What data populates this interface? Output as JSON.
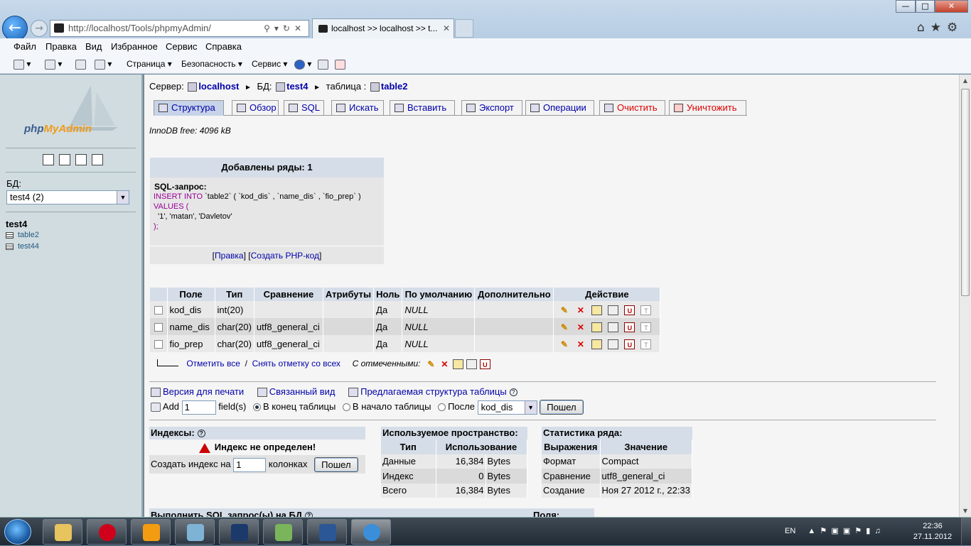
{
  "browser": {
    "address": "http://localhost/Tools/phpmyAdmin/",
    "tab_title": "localhost >> localhost >> t...",
    "menu": [
      "Файл",
      "Правка",
      "Вид",
      "Избранное",
      "Сервис",
      "Справка"
    ],
    "cmd": {
      "page": "Страница",
      "safety": "Безопасность",
      "service": "Сервис"
    }
  },
  "left": {
    "logo_part1": "php",
    "logo_part2": "MyAdmin",
    "db_label": "БД:",
    "db_select": "test4 (2)",
    "db_name": "test4",
    "tables": [
      "table2",
      "test44"
    ]
  },
  "breadcrumb": {
    "server_label": "Сервер:",
    "server": "localhost",
    "db_label": "БД:",
    "db": "test4",
    "table_label": "таблица :",
    "table": "table2"
  },
  "tabs": [
    "Структура",
    "Обзор",
    "SQL",
    "Искать",
    "Вставить",
    "Экспорт",
    "Операции",
    "Очистить",
    "Уничтожить"
  ],
  "innodb": "InnoDB free: 4096 kB",
  "result": {
    "title": "Добавлены ряды: 1",
    "sql_label": "SQL-запрос:",
    "line1_kw": "INSERT INTO",
    "line1_rest": " `table2` ( `kod_dis` , `name_dis` , `fio_prep` )",
    "line2": "VALUES (",
    "line3": "  '1', 'matan', 'Davletov'",
    "line4": ");",
    "link_edit": "Правка",
    "link_php": "Создать PHP-код"
  },
  "structure": {
    "headers": [
      "Поле",
      "Тип",
      "Сравнение",
      "Атрибуты",
      "Ноль",
      "По умолчанию",
      "Дополнительно",
      "Действие"
    ],
    "rows": [
      {
        "field": "kod_dis",
        "type": "int(20)",
        "collation": "",
        "attributes": "",
        "null": "Да",
        "default": "NULL",
        "extra": ""
      },
      {
        "field": "name_dis",
        "type": "char(20)",
        "collation": "utf8_general_ci",
        "attributes": "",
        "null": "Да",
        "default": "NULL",
        "extra": ""
      },
      {
        "field": "fio_prep",
        "type": "char(20)",
        "collation": "utf8_general_ci",
        "attributes": "",
        "null": "Да",
        "default": "NULL",
        "extra": ""
      }
    ],
    "check_all": "Отметить все",
    "sep": "/",
    "uncheck_all": "Снять отметку со всех",
    "with_selected": "С отмеченными:"
  },
  "links": {
    "print": "Версия для печати",
    "relation": "Связанный вид",
    "propose": "Предлагаемая структура таблицы"
  },
  "addfield": {
    "add": "Add",
    "count": "1",
    "fields": "field(s)",
    "opt_end": "В конец таблицы",
    "opt_begin": "В начало таблицы",
    "opt_after": "После",
    "after_field": "kod_dis",
    "go": "Пошел"
  },
  "indexes": {
    "title": "Индексы:",
    "none": "Индекс не определен!",
    "create_label": "Создать индекс на",
    "count": "1",
    "columns": "колонках",
    "go": "Пошел"
  },
  "space": {
    "title": "Используемое пространство:",
    "headers": [
      "Тип",
      "Использование"
    ],
    "rows": [
      {
        "type": "Данные",
        "value": "16,384",
        "unit": "Bytes"
      },
      {
        "type": "Индекс",
        "value": "0",
        "unit": "Bytes"
      },
      {
        "type": "Всего",
        "value": "16,384",
        "unit": "Bytes"
      }
    ]
  },
  "rowstats": {
    "title": "Статистика ряда:",
    "headers": [
      "Выражения",
      "Значение"
    ],
    "rows": [
      {
        "k": "Формат",
        "v": "Compact"
      },
      {
        "k": "Сравнение",
        "v": "utf8_general_ci"
      },
      {
        "k": "Создание",
        "v": "Ноя 27 2012 г., 22:33"
      }
    ]
  },
  "bottom": {
    "run_sql": "Выполнить SQL запрос(ы) на БД",
    "fields": "Поля:"
  },
  "taskbar": {
    "lang": "EN",
    "time": "22:36",
    "date": "27.11.2012"
  }
}
